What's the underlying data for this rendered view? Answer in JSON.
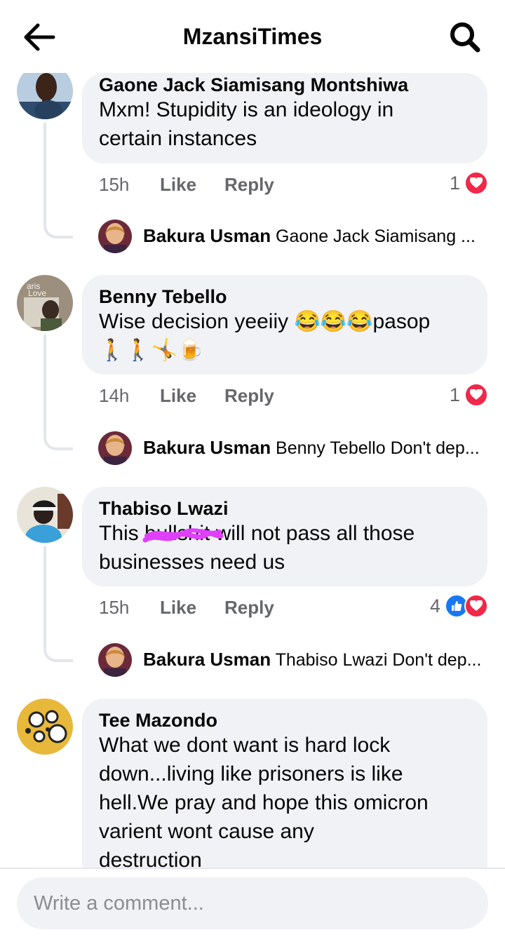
{
  "header": {
    "title": "MzansiTimes",
    "back_icon": "arrow-left-icon",
    "search_icon": "search-icon"
  },
  "actions": {
    "like_label": "Like",
    "reply_label": "Reply"
  },
  "comments": [
    {
      "author": "Gaone Jack Siamisang Montshiwa",
      "text": "Mxm! Stupidity is an ideology in\ncertain instances",
      "time": "15h",
      "reaction_count": "1",
      "reactions": [
        "heart"
      ],
      "reply": {
        "author": "Bakura Usman",
        "preview": "Gaone Jack Siamisang ..."
      }
    },
    {
      "author": "Benny Tebello",
      "text": "Wise decision yeeiiy 😂😂😂pasop\n🚶🚶🤸🍺",
      "time": "14h",
      "reaction_count": "1",
      "reactions": [
        "heart"
      ],
      "reply": {
        "author": "Bakura Usman",
        "preview": "Benny Tebello Don't dep..."
      }
    },
    {
      "author": "Thabiso Lwazi",
      "text": "This bullshit will not pass all those\nbusinesses need us",
      "time": "15h",
      "reaction_count": "4",
      "reactions": [
        "like",
        "heart"
      ],
      "reply": {
        "author": "Bakura Usman",
        "preview": "Thabiso Lwazi Don't dep..."
      }
    },
    {
      "author": "Tee Mazondo",
      "text": "What we dont want is hard lock\ndown...living like prisoners is like\nhell.We pray and hope this omicron\nvarient wont cause any\ndestruction"
    }
  ],
  "composer": {
    "placeholder": "Write a comment..."
  },
  "colors": {
    "bubble": "#f0f2f5",
    "meta_text": "#65676b",
    "heart": "#f02849",
    "like": "#1877f2",
    "scribble": "#e040fb"
  }
}
